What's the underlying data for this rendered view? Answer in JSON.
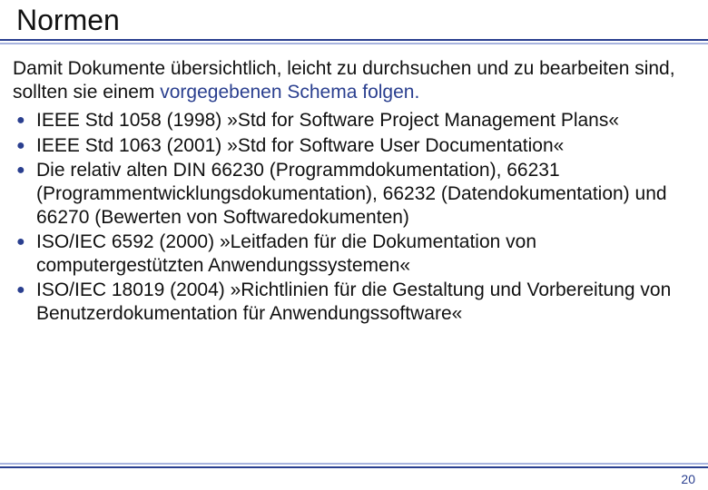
{
  "title": "Normen",
  "intro_plain": "Damit Dokumente übersichtlich, leicht zu durchsuchen und zu bearbeiten sind, sollten sie einem ",
  "intro_highlight": "vorgegebenen Schema folgen.",
  "bullets": [
    "IEEE Std 1058 (1998)  »Std for Software Project Management Plans«",
    "IEEE Std 1063 (2001)  »Std for Software User Documentation«",
    "Die relativ alten DIN 66230 (Programmdokumentation), 66231 (Programmentwicklungsdokumentation), 66232 (Datendokumentation) und 66270 (Bewerten von Softwaredokumenten)",
    "ISO/IEC 6592 (2000)  »Leitfaden für die Dokumentation von computergestützten Anwendungssystemen«",
    "ISO/IEC 18019 (2004)  »Richtlinien für die Gestaltung und Vorbereitung von Benutzerdokumentation für Anwendungssoftware«"
  ],
  "page_number": "20"
}
